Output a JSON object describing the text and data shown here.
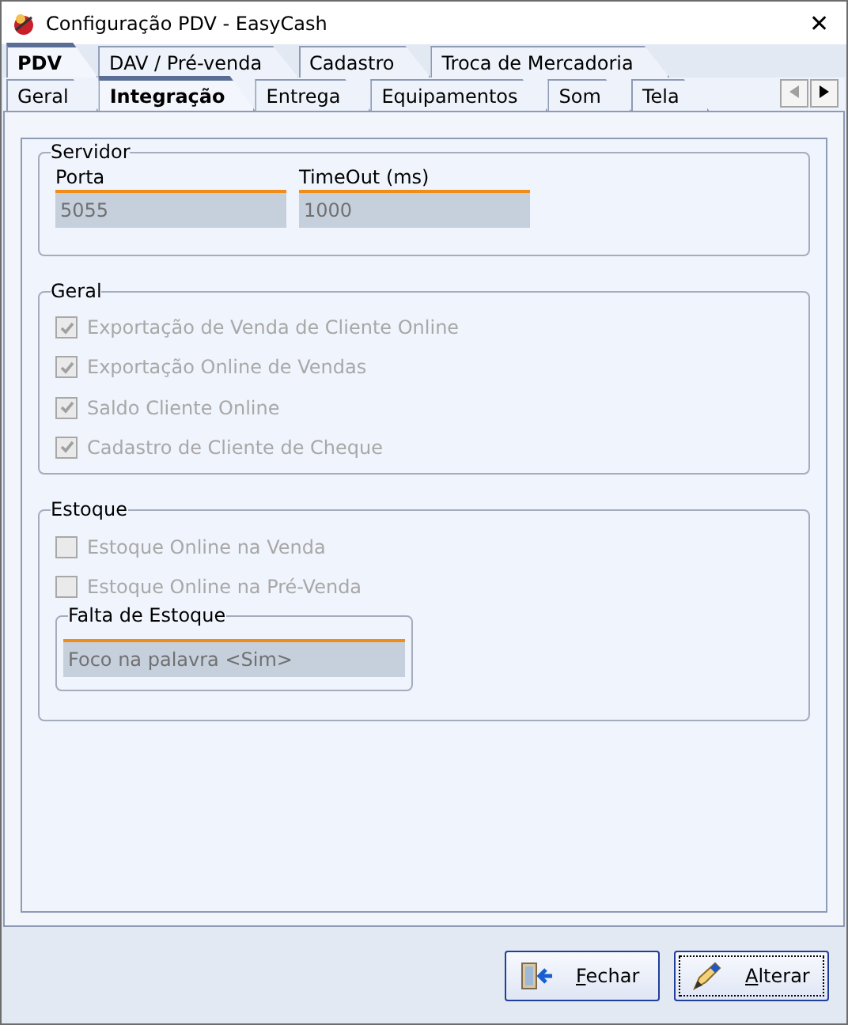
{
  "window": {
    "title": "Configuração PDV - EasyCash",
    "close": "✕"
  },
  "tabs": [
    {
      "label": "PDV",
      "selected": true
    },
    {
      "label": "DAV / Pré-venda",
      "selected": false
    },
    {
      "label": "Cadastro",
      "selected": false
    },
    {
      "label": "Troca de Mercadoria",
      "selected": false
    }
  ],
  "subtabs": [
    {
      "label": "Geral",
      "selected": false
    },
    {
      "label": "Integração",
      "selected": true
    },
    {
      "label": "Entrega",
      "selected": false
    },
    {
      "label": "Equipamentos",
      "selected": false
    },
    {
      "label": "Som",
      "selected": false
    },
    {
      "label": "Tela",
      "selected": false
    }
  ],
  "servidor": {
    "title": "Servidor",
    "fields": [
      {
        "label": "Porta",
        "value": "5055"
      },
      {
        "label": "TimeOut (ms)",
        "value": "1000"
      }
    ]
  },
  "geral": {
    "title": "Geral",
    "options": [
      {
        "label": "Exportação de Venda de Cliente Online",
        "checked": true,
        "disabled": true
      },
      {
        "label": "Exportação Online de Vendas",
        "checked": true,
        "disabled": true
      },
      {
        "label": "Saldo Cliente Online",
        "checked": true,
        "disabled": true
      },
      {
        "label": "Cadastro de Cliente de Cheque",
        "checked": true,
        "disabled": true
      }
    ]
  },
  "estoque": {
    "title": "Estoque",
    "options": [
      {
        "label": "Estoque Online na Venda",
        "checked": false,
        "disabled": true
      },
      {
        "label": "Estoque Online na Pré-Venda",
        "checked": false,
        "disabled": true
      }
    ],
    "falta": {
      "title": "Falta de Estoque",
      "value": "Foco na palavra <Sim>"
    }
  },
  "buttons": [
    {
      "label": "Fechar",
      "kind": "close"
    },
    {
      "label": "Alterar",
      "kind": "edit"
    }
  ]
}
